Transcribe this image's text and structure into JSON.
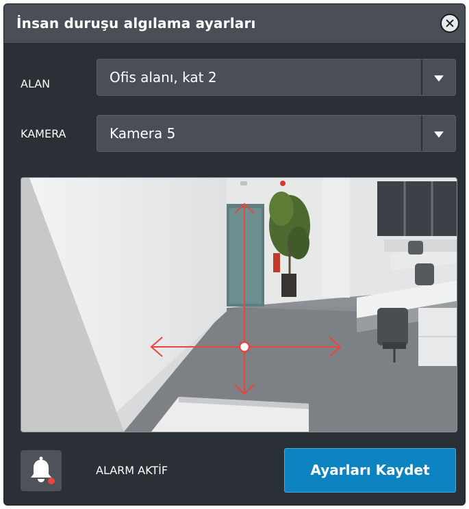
{
  "dialog": {
    "title": "İnsan duruşu algılama ayarları",
    "close_icon": "close-icon"
  },
  "fields": {
    "area": {
      "label": "ALAN",
      "value": "Ofis alanı, kat 2",
      "arrow_icon": "chevron-down-icon"
    },
    "camera": {
      "label": "KAMERA",
      "value": "Kamera 5",
      "arrow_icon": "chevron-down-icon"
    }
  },
  "camera_view": {
    "overlay": "move-crosshair",
    "overlay_color": "#e8453c"
  },
  "footer": {
    "alarm_icon": "bell-icon",
    "alarm_status_color": "#e8453c",
    "alarm_label": "ALARM AKTİF",
    "save_label": "Ayarları Kaydet"
  },
  "colors": {
    "background": "#2b2f36",
    "header": "#4a4e57",
    "accent": "#0d83c1"
  }
}
